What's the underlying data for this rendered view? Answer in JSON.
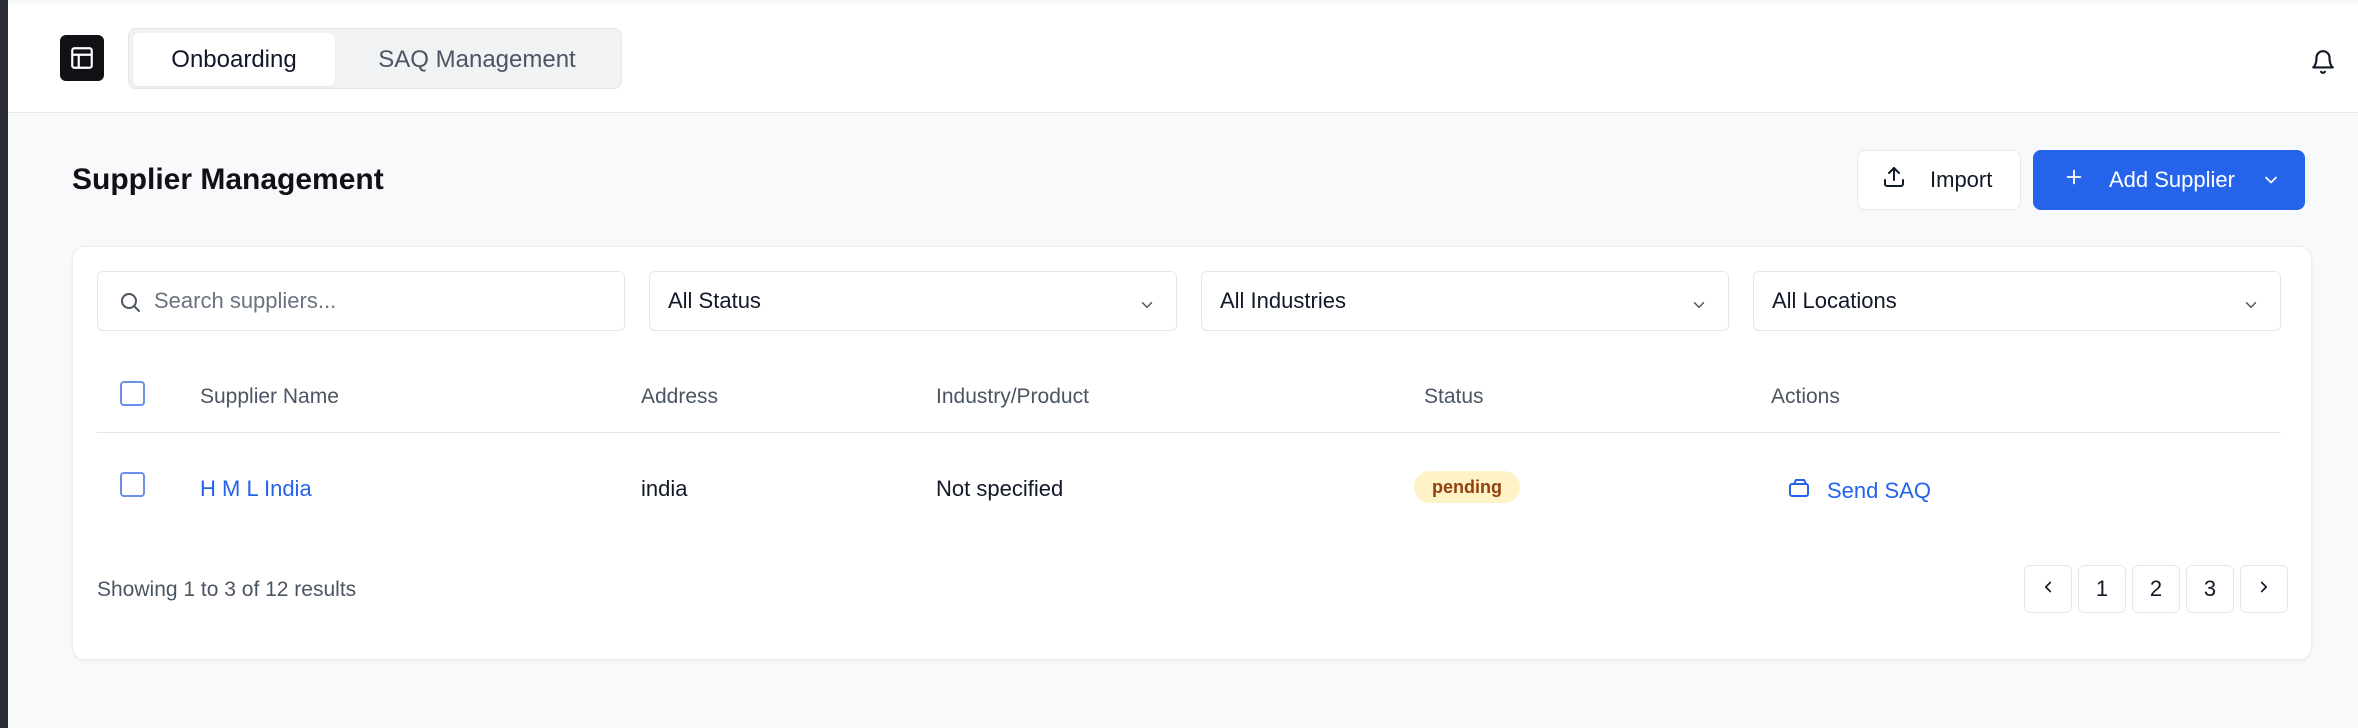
{
  "nav": {
    "tabs": [
      {
        "label": "Onboarding",
        "active": true
      },
      {
        "label": "SAQ Management",
        "active": false
      }
    ]
  },
  "header": {
    "title": "Supplier Management",
    "import_label": "Import",
    "add_label": "Add Supplier"
  },
  "filters": {
    "search_placeholder": "Search suppliers...",
    "status": "All Status",
    "industries": "All Industries",
    "locations": "All Locations"
  },
  "table": {
    "columns": [
      "Supplier Name",
      "Address",
      "Industry/Product",
      "Status",
      "Actions"
    ],
    "rows": [
      {
        "name": "H M L India",
        "address": "india",
        "industry": "Not specified",
        "status": "pending",
        "action": "Send SAQ"
      }
    ]
  },
  "pagination": {
    "summary": "Showing 1 to 3 of 12 results",
    "pages": [
      "1",
      "2",
      "3"
    ]
  },
  "colors": {
    "accent": "#2563eb",
    "pending_bg": "#fef3c7",
    "pending_text": "#92400e"
  },
  "icons": [
    "layout-icon",
    "bell-icon",
    "upload-icon",
    "plus-icon",
    "chevron-down-icon",
    "search-icon",
    "send-icon",
    "chevron-left-icon",
    "chevron-right-icon"
  ]
}
